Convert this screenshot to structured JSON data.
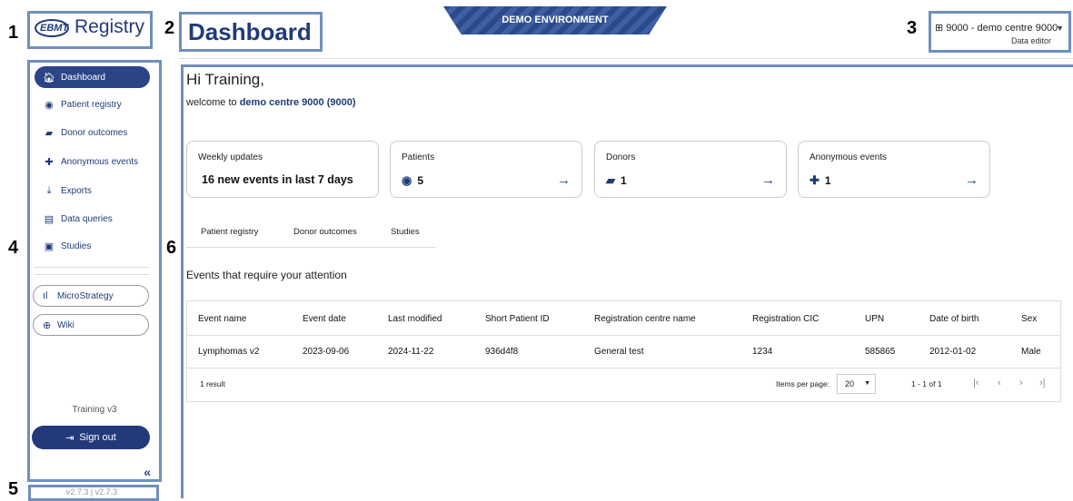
{
  "callouts": [
    "1",
    "2",
    "3",
    "4",
    "5",
    "6"
  ],
  "logo": {
    "ebmt": "EBMT",
    "registry": "Registry"
  },
  "header": {
    "title": "Dashboard",
    "demo_banner": "DEMO ENVIRONMENT",
    "centre": {
      "icon": "building-icon",
      "label": "9000 - demo centre 9000",
      "role": "Data editor"
    }
  },
  "sidebar": {
    "items": [
      {
        "label": "Dashboard",
        "icon": "home-icon"
      },
      {
        "label": "Patient registry",
        "icon": "user-circle-icon"
      },
      {
        "label": "Donor outcomes",
        "icon": "folder-user-icon"
      },
      {
        "label": "Anonymous events",
        "icon": "medical-case-icon"
      },
      {
        "label": "Exports",
        "icon": "download-icon"
      },
      {
        "label": "Data queries",
        "icon": "message-icon"
      },
      {
        "label": "Studies",
        "icon": "archive-icon"
      }
    ],
    "links": [
      {
        "label": "MicroStrategy",
        "icon": "bar-chart-icon"
      },
      {
        "label": "Wiki",
        "icon": "globe-icon"
      }
    ],
    "training": "Training v3",
    "sign_out": "Sign out",
    "collapse": "«",
    "version": "v2.7.3 | v2.7.3"
  },
  "main": {
    "greeting": "Hi Training,",
    "welcome_prefix": "welcome to ",
    "welcome_centre": "demo centre 9000 (9000)",
    "cards": [
      {
        "title": "Weekly updates",
        "value": "16 new events in last 7 days"
      },
      {
        "title": "Patients",
        "value": "5",
        "icon": "user-circle-icon"
      },
      {
        "title": "Donors",
        "value": "1",
        "icon": "folder-user-icon"
      },
      {
        "title": "Anonymous events",
        "value": "1",
        "icon": "medical-case-icon"
      }
    ],
    "tabs": [
      "Patient registry",
      "Donor outcomes",
      "Studies"
    ],
    "attention_title": "Events that require your attention",
    "table": {
      "headers": [
        "Event name",
        "Event date",
        "Last modified",
        "Short Patient ID",
        "Registration centre name",
        "Registration CIC",
        "UPN",
        "Date of birth",
        "Sex"
      ],
      "rows": [
        [
          "Lymphomas v2",
          "2023-09-06",
          "2024-11-22",
          "936d4f8",
          "General test",
          "1234",
          "585865",
          "2012-01-02",
          "Male"
        ]
      ],
      "result_count": "1 result",
      "items_per_page_label": "Items per page:",
      "items_per_page": "20",
      "range": "1 - 1 of 1"
    }
  }
}
